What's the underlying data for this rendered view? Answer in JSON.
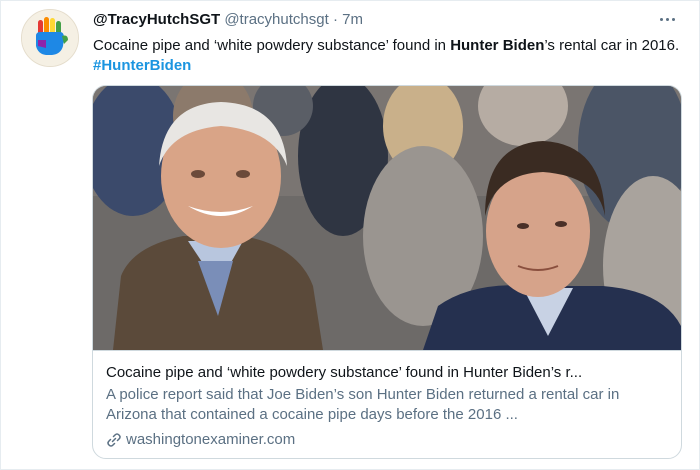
{
  "tweet": {
    "display_name": "@TracyHutchSGT",
    "handle": "@tracyhutchsgt",
    "separator": "·",
    "timestamp": "7m",
    "text_parts": [
      "Cocaine pipe and ‘white powdery substance’ found in ",
      "Hunter Biden",
      "’s rental car in 2016. ",
      "#HunterBiden"
    ]
  },
  "card": {
    "title": "Cocaine pipe and ‘white powdery substance’ found in Hunter Biden’s r...",
    "description": "A police report said that Joe Biden’s son Hunter Biden returned a rental car in Arizona that contained a cocaine pipe days before the 2016 ...",
    "domain": "washingtonexaminer.com"
  },
  "icons": {
    "more": "more-options-icon",
    "link": "link-icon",
    "avatar": "rainbow-hand-avatar-icon"
  }
}
